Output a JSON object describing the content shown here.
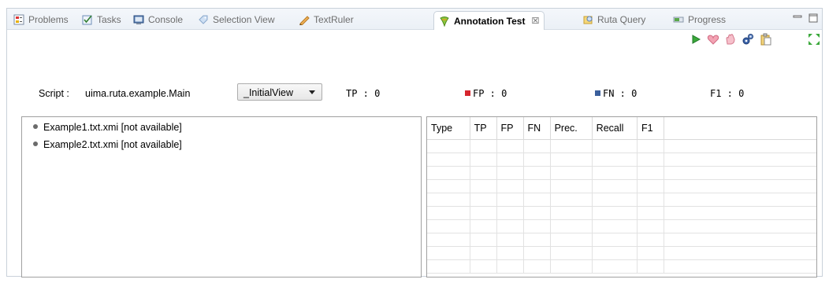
{
  "tabs": [
    {
      "label": "Problems",
      "icon": "problems-icon"
    },
    {
      "label": "Tasks",
      "icon": "tasks-icon"
    },
    {
      "label": "Console",
      "icon": "console-icon"
    },
    {
      "label": "Selection View",
      "icon": "selection-view-icon"
    },
    {
      "label": "TextRuler",
      "icon": "textruler-icon"
    },
    {
      "label": "Annotation Test",
      "icon": "annotation-test-icon",
      "active": true
    },
    {
      "label": "Ruta Query",
      "icon": "ruta-query-icon"
    },
    {
      "label": "Progress",
      "icon": "progress-icon"
    }
  ],
  "tab_close_glyph": "☒",
  "toolbar": {
    "icons": [
      "run-icon",
      "heart-icon",
      "hand-icon",
      "gears-icon",
      "clipboard-icon",
      "expand-icon"
    ]
  },
  "script": {
    "label": "Script :",
    "name": "uima.ruta.example.Main",
    "view_select": "_InitialView"
  },
  "metrics": {
    "tp_label": "TP :",
    "tp_value": "0",
    "fp_label": "FP :",
    "fp_value": "0",
    "fn_label": "FN :",
    "fn_value": "0",
    "f1_label": "F1 :",
    "f1_value": "0"
  },
  "colors": {
    "fp_marker": "#d6262e",
    "fn_marker": "#3b5f9c",
    "active_tab_text": "#000000",
    "inactive_tab_text": "#6d6d6d"
  },
  "files": [
    "Example1.txt.xmi [not available]",
    "Example2.txt.xmi [not available]"
  ],
  "table": {
    "columns": [
      "Type",
      "TP",
      "FP",
      "FN",
      "Prec.",
      "Recall",
      "F1"
    ],
    "rows": []
  }
}
